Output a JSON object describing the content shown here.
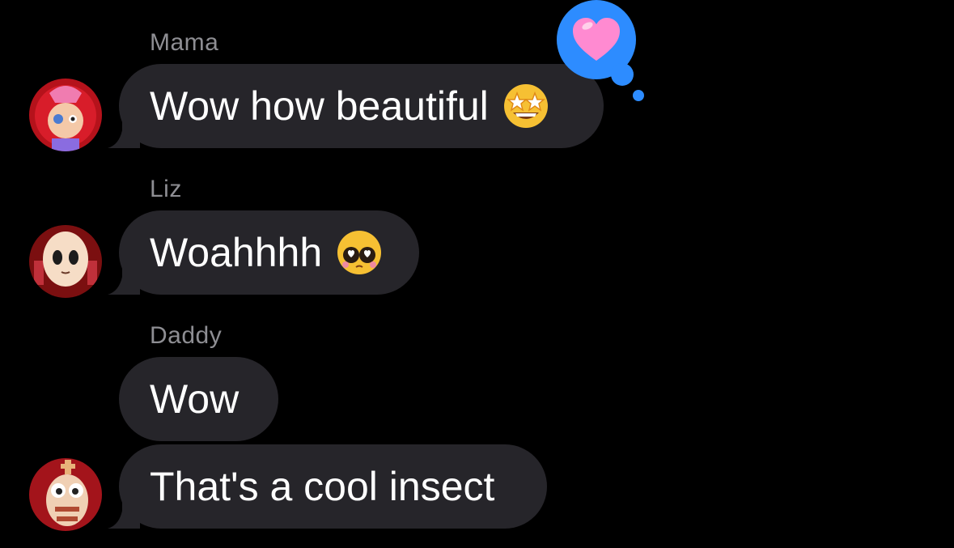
{
  "messages": [
    {
      "sender": "Mama",
      "text": "Wow how beautiful",
      "emoji": "star-struck-emoji",
      "avatar": "ragdoll-avatar",
      "reaction": "heart-icon"
    },
    {
      "sender": "Liz",
      "text": "Woahhhh",
      "emoji": "pleading-face-emoji",
      "avatar": "mannequin-avatar"
    },
    {
      "sender": "Daddy",
      "text": "Wow"
    },
    {
      "text": "That's a cool insect",
      "avatar": "jester-avatar"
    }
  ],
  "colors": {
    "background": "#000000",
    "bubble": "#26252a",
    "text": "#ffffff",
    "sender": "#8e8e93",
    "tapback": "#2d8cff",
    "heart": "#ff8ad1"
  }
}
